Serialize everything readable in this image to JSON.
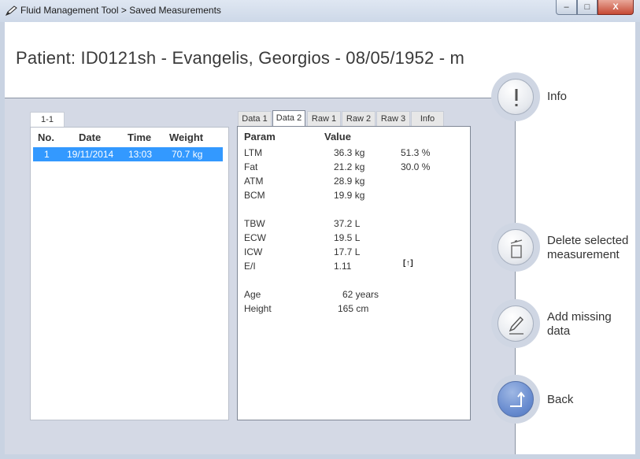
{
  "window": {
    "title": "Fluid Management Tool > Saved Measurements",
    "min_glyph": "–",
    "max_glyph": "□",
    "close_glyph": "X"
  },
  "header": {
    "title": "Patient: ID0121sh - Evangelis, Georgios - 08/05/1952 - m"
  },
  "list": {
    "tab_label": "1-1",
    "columns": [
      "No.",
      "Date",
      "Time",
      "Weight"
    ],
    "rows": [
      {
        "no": "1",
        "date": "19/11/2014",
        "time": "13:03",
        "weight": "70.7 kg",
        "selected": true
      }
    ]
  },
  "data_tabs": [
    {
      "label": "Data 1",
      "active": false
    },
    {
      "label": "Data 2",
      "active": true
    },
    {
      "label": "Raw 1",
      "active": false
    },
    {
      "label": "Raw 2",
      "active": false
    },
    {
      "label": "Raw 3",
      "active": false
    },
    {
      "label": "Info",
      "active": false
    }
  ],
  "data_panel": {
    "header_param": "Param",
    "header_value": "Value",
    "rows": {
      "ltm": {
        "param": "LTM",
        "value": "36.3 kg",
        "extra": "51.3 %"
      },
      "fat": {
        "param": "Fat",
        "value": "21.2 kg",
        "extra": "30.0 %"
      },
      "atm": {
        "param": "ATM",
        "value": "28.9 kg"
      },
      "bcm": {
        "param": "BCM",
        "value": "19.9 kg"
      },
      "tbw": {
        "param": "TBW",
        "value": "37.2 L"
      },
      "ecw": {
        "param": "ECW",
        "value": "19.5 L"
      },
      "icw": {
        "param": "ICW",
        "value": "17.7 L"
      },
      "ei": {
        "param": "E/I",
        "value": "1.11",
        "extra": "[↑]"
      },
      "age": {
        "param": "Age",
        "value": "62 years"
      },
      "height": {
        "param": "Height",
        "value": "165 cm"
      }
    }
  },
  "actions": {
    "info": {
      "label": "Info",
      "icon": "exclamation-icon"
    },
    "delete": {
      "label_line1": "Delete selected",
      "label_line2": "measurement",
      "icon": "trash-icon"
    },
    "add_missing": {
      "label_line1": "Add missing",
      "label_line2": "data",
      "icon": "pencil-icon"
    },
    "back": {
      "label": "Back",
      "icon": "return-arrow-icon"
    }
  },
  "colors": {
    "selection": "#3399ff",
    "panel_background": "#d4d9e5",
    "back_button": "#6a8dd0"
  }
}
